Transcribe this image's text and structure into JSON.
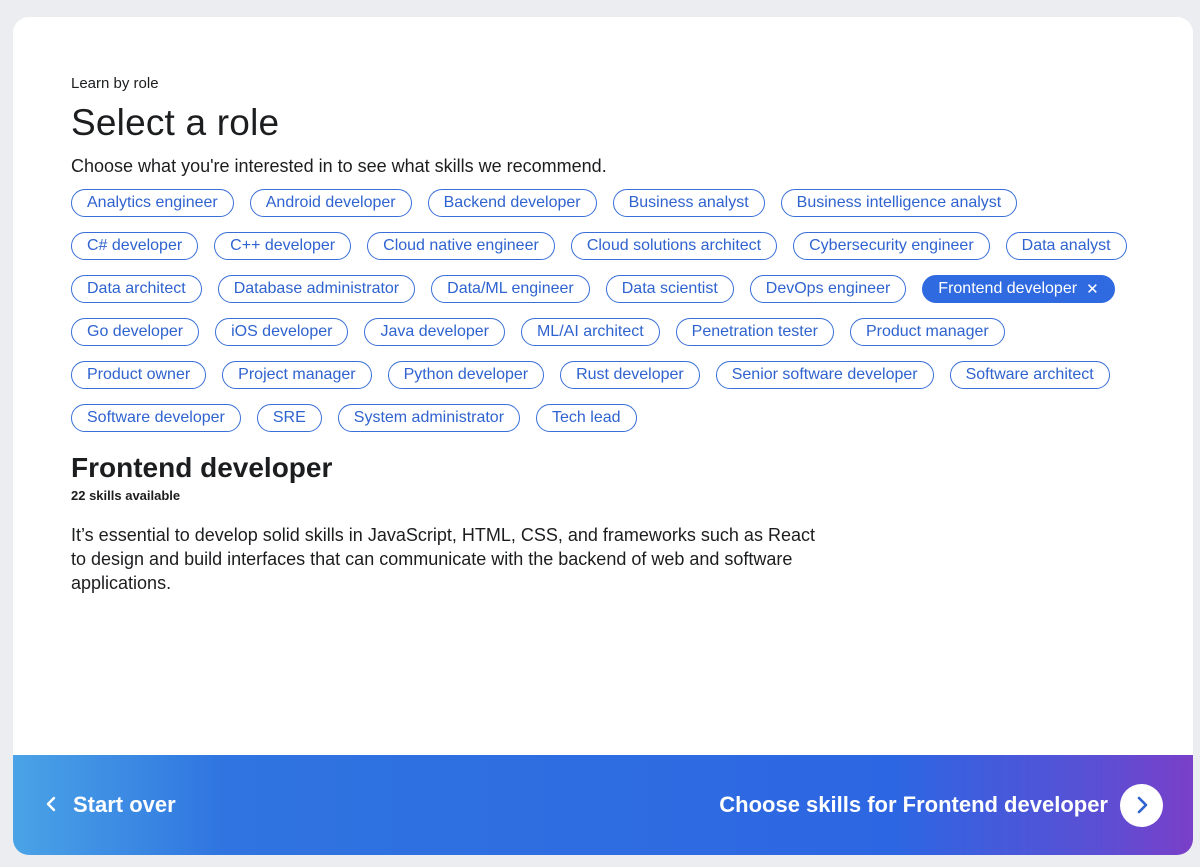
{
  "header": {
    "eyebrow": "Learn by role",
    "title": "Select a role",
    "subtitle": "Choose what you're interested in to see what skills we recommend."
  },
  "roles": [
    "Analytics engineer",
    "Android developer",
    "Backend developer",
    "Business analyst",
    "Business intelligence analyst",
    "C# developer",
    "C++ developer",
    "Cloud native engineer",
    "Cloud solutions architect",
    "Cybersecurity engineer",
    "Data analyst",
    "Data architect",
    "Database administrator",
    "Data/ML engineer",
    "Data scientist",
    "DevOps engineer",
    "Frontend developer",
    "Go developer",
    "iOS developer",
    "Java developer",
    "ML/AI architect",
    "Penetration tester",
    "Product manager",
    "Product owner",
    "Project manager",
    "Python developer",
    "Rust developer",
    "Senior software developer",
    "Software architect",
    "Software developer",
    "SRE",
    "System administrator",
    "Tech lead"
  ],
  "selected_role": "Frontend developer",
  "chip_remove_glyph": "✕",
  "detail": {
    "title": "Frontend developer",
    "skills_count": "22 skills available",
    "description": "It’s essential to develop solid skills in JavaScript, HTML, CSS, and frameworks such as React to design and build interfaces that can communicate with the backend of web and software applications."
  },
  "footer": {
    "start_over_label": "Start over",
    "choose_label": "Choose skills for Frontend developer"
  },
  "icons": {
    "back": "chevron-left-icon",
    "next": "chevron-right-icon",
    "remove": "close-icon"
  },
  "colors": {
    "accent": "#2f6ae0",
    "chip_text": "#2f63cf",
    "footer_gradient_start": "#4aa3e6",
    "footer_gradient_end": "#7a3fc8"
  }
}
